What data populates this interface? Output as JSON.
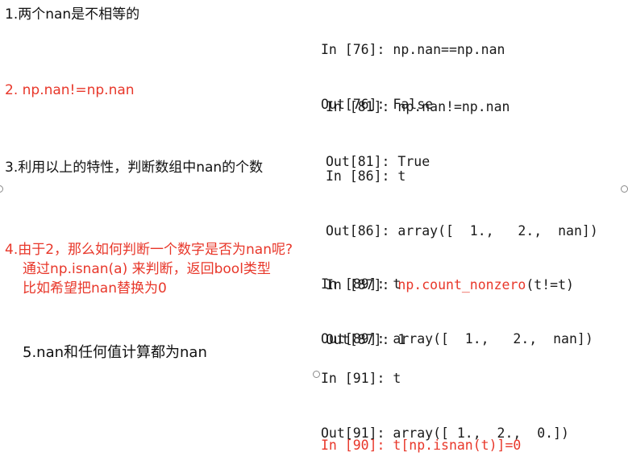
{
  "notes": {
    "n1": "1.两个nan是不相等的",
    "n2": "2. np.nan!=np.nan",
    "n3": "3.利用以上的特性，判断数组中nan的个数",
    "n4_line1": "4.由于2，那么如何判断一个数字是否为nan呢?",
    "n4_line2": "通过np.isnan(a) 来判断，返回bool类型",
    "n4_line3": "比如希望把nan替换为0",
    "n5": "5.nan和任何值计算都为nan"
  },
  "code": {
    "b1": {
      "in_prompt": "In [76]: ",
      "in_code": "np.nan==np.nan",
      "out_prompt": "Out[76]: ",
      "out_value": "False"
    },
    "b2": {
      "in_prompt": "In [81]: ",
      "in_code": "np.nan!=np.nan",
      "out_prompt": "Out[81]: ",
      "out_value": "True"
    },
    "b3": {
      "in1_prompt": "In [86]: ",
      "in1_code": "t",
      "out1_prompt": "Out[86]: ",
      "out1_value": "array([  1.,   2.,  nan])",
      "in2_prompt": "In [87]: ",
      "in2_func": "np.count_nonzero",
      "in2_args": "(t!=t)",
      "out2_prompt": "Out[87]: ",
      "out2_value": "1"
    },
    "b4": {
      "in1_prompt": "In [89]: ",
      "in1_code": "t",
      "out1_prompt": "Out[89]: ",
      "out1_value": "array([  1.,   2.,  nan])",
      "in2_line": "In [90]: t[np.isnan(t)]=0"
    },
    "b5": {
      "in_prompt": "In [91]: ",
      "in_code": "t",
      "out_prompt": "Out[91]: ",
      "out_value": "array([ 1.,  2.,  0.])"
    }
  },
  "colors": {
    "accent_red": "#e8372a",
    "text": "#111111",
    "handle_border": "#8a8a8a"
  }
}
